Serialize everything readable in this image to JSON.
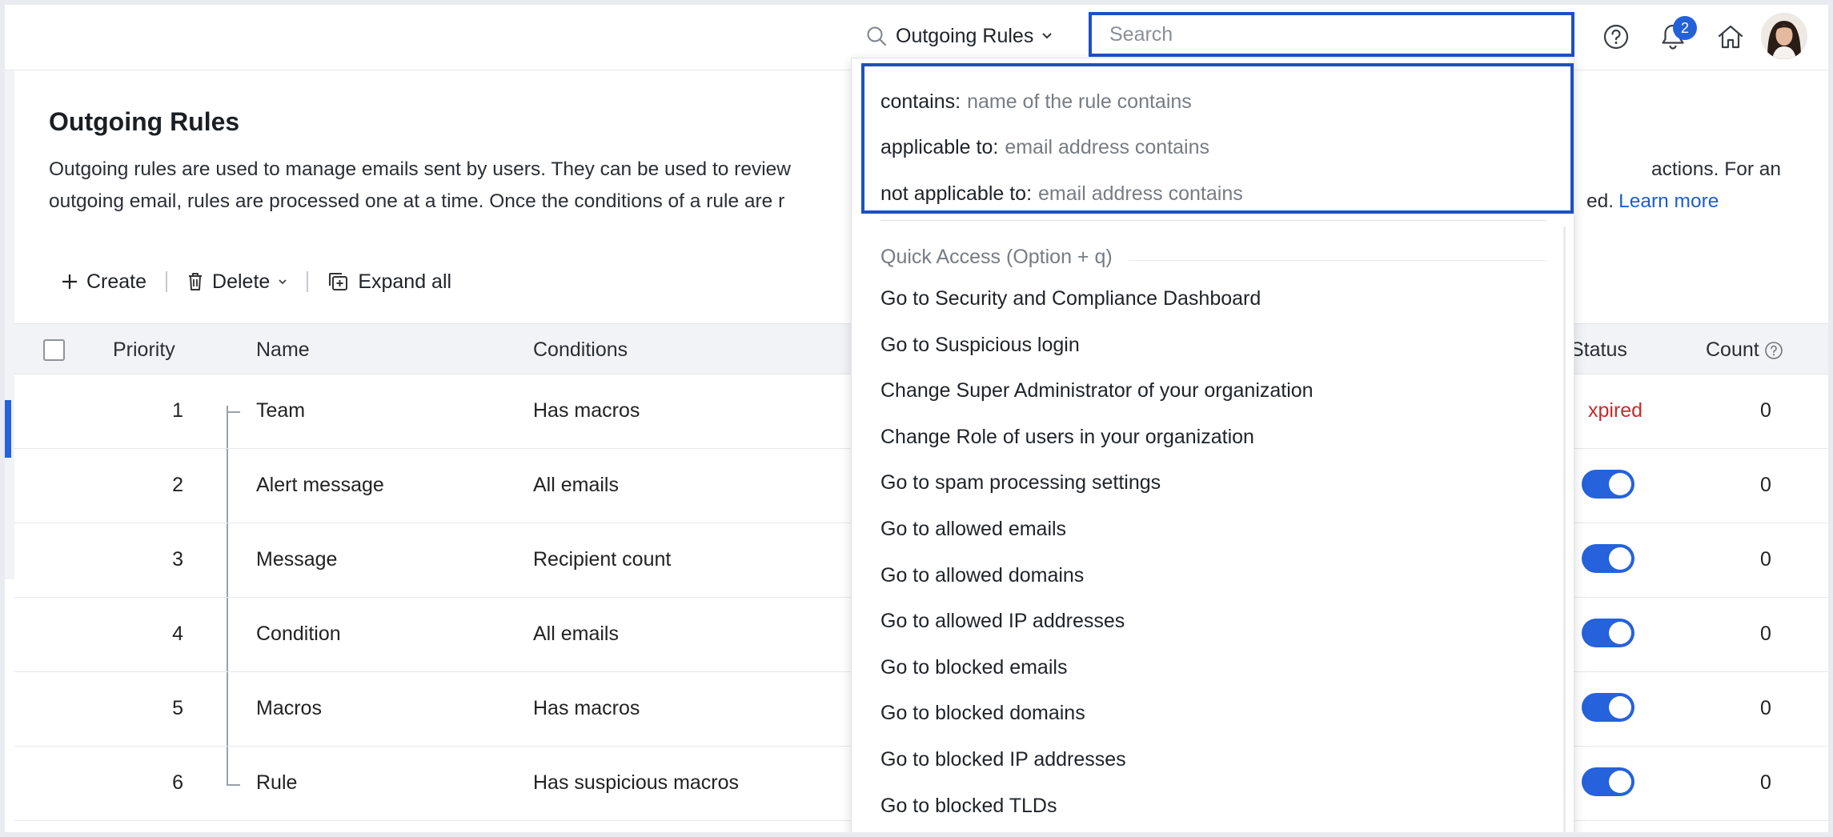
{
  "topbar": {
    "scope_label": "Outgoing Rules",
    "search_placeholder": "Search",
    "notification_count": "2"
  },
  "search_suggestions": [
    {
      "key": "contains:",
      "value": "name of the rule contains"
    },
    {
      "key": "applicable to:",
      "value": "email address contains"
    },
    {
      "key": "not applicable to:",
      "value": "email address contains"
    }
  ],
  "quick_access": {
    "title": "Quick Access (Option + q)",
    "items": [
      "Go to Security and Compliance Dashboard",
      "Go to Suspicious login",
      "Change Super Administrator of your organization",
      "Change Role of users in your organization",
      "Go to spam processing settings",
      "Go to allowed emails",
      "Go to allowed domains",
      "Go to allowed IP addresses",
      "Go to blocked emails",
      "Go to blocked domains",
      "Go to blocked IP addresses",
      "Go to blocked TLDs"
    ]
  },
  "page": {
    "title": "Outgoing Rules",
    "desc_line1_left": "Outgoing rules are used to manage emails sent by users. They can be used to review",
    "desc_line1_right": "actions. For an",
    "desc_line2_left": "outgoing email, rules are processed one at a time. Once the conditions of a rule are r",
    "desc_line2_right": "ed.",
    "learn_more": "Learn more"
  },
  "toolbar": {
    "create": "Create",
    "delete": "Delete",
    "expand_all": "Expand all"
  },
  "table": {
    "headers": {
      "priority": "Priority",
      "name": "Name",
      "conditions": "Conditions",
      "status": "Status",
      "count": "Count"
    },
    "rows": [
      {
        "priority": "1",
        "name": "Team",
        "conditions": "Has macros",
        "status": "xpired",
        "enabled": null,
        "count": "0"
      },
      {
        "priority": "2",
        "name": "Alert message",
        "conditions": "All emails",
        "status": "",
        "enabled": true,
        "count": "0"
      },
      {
        "priority": "3",
        "name": "Message",
        "conditions": "Recipient count",
        "status": "",
        "enabled": true,
        "count": "0"
      },
      {
        "priority": "4",
        "name": "Condition",
        "conditions": "All emails",
        "status": "",
        "enabled": true,
        "count": "0"
      },
      {
        "priority": "5",
        "name": "Macros",
        "conditions": "Has macros",
        "status": "",
        "enabled": true,
        "count": "0"
      },
      {
        "priority": "6",
        "name": "Rule",
        "conditions": "Has suspicious macros",
        "status": "",
        "enabled": true,
        "count": "0"
      }
    ]
  },
  "colors": {
    "accent": "#1d50c2",
    "toggle_on": "#2562db",
    "expired": "#c62a2a",
    "link": "#1f5ec9"
  }
}
